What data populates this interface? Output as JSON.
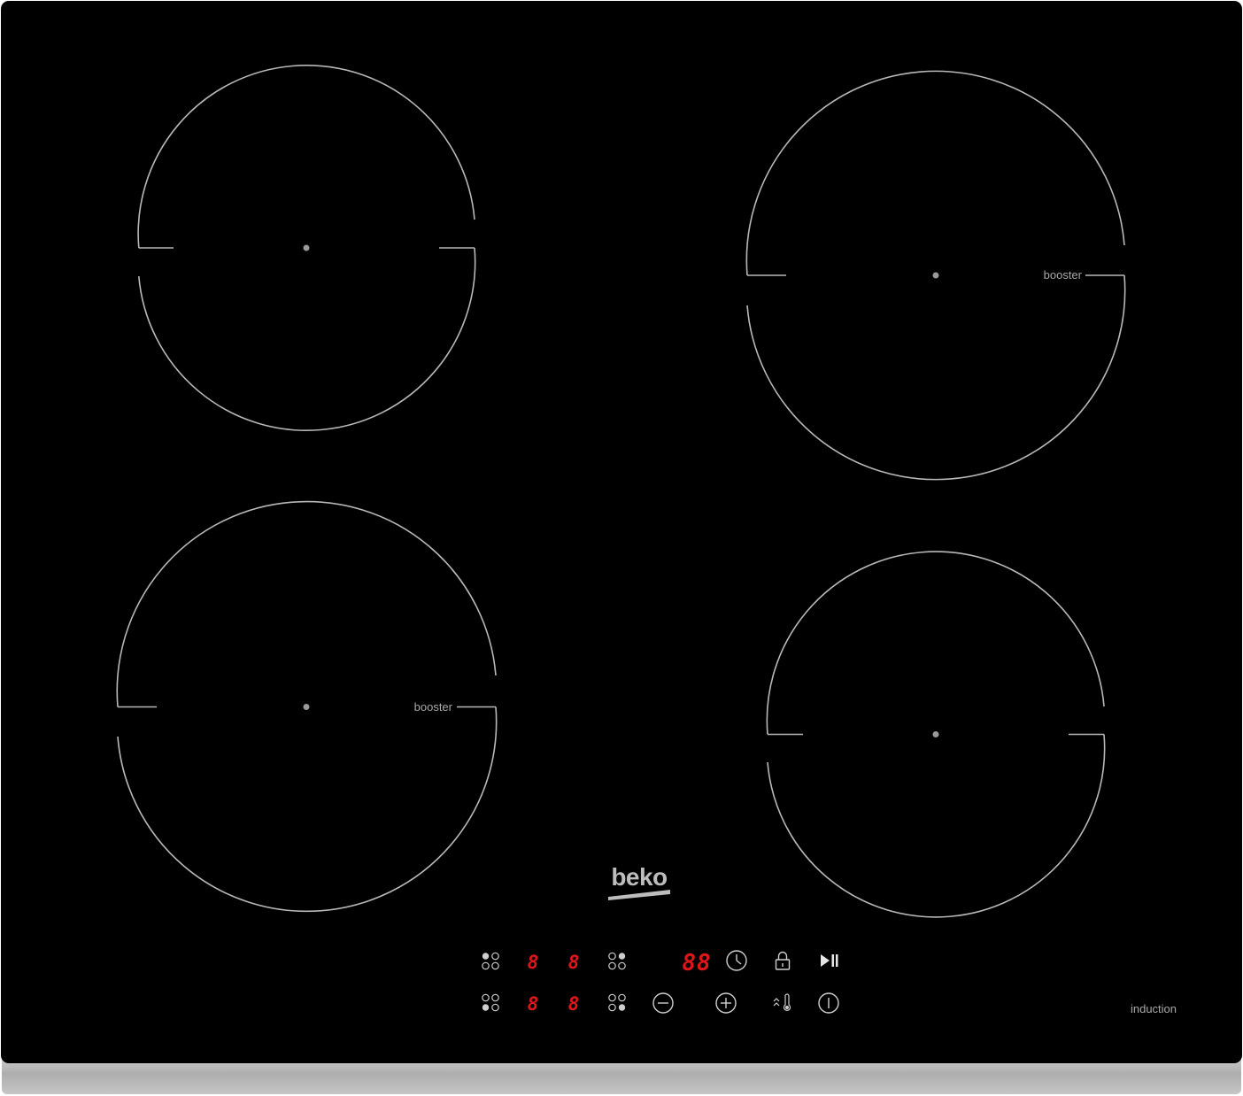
{
  "brand": "beko",
  "cooktop_type_label": "induction",
  "zones": [
    {
      "id": "rear-left",
      "label": ""
    },
    {
      "id": "rear-right",
      "label": "booster"
    },
    {
      "id": "front-left",
      "label": "booster"
    },
    {
      "id": "front-right",
      "label": ""
    }
  ],
  "control_panel": {
    "zone_selectors": [
      {
        "icon": "zone-selector-rear-left-icon"
      },
      {
        "icon": "zone-selector-rear-right-icon"
      },
      {
        "icon": "zone-selector-front-left-icon"
      },
      {
        "icon": "zone-selector-front-right-icon"
      }
    ],
    "power_digits": {
      "rear_left": "8",
      "rear_right": "8",
      "front_left": "8",
      "front_right": "8"
    },
    "timer_display": "88",
    "buttons": {
      "timer": "clock-icon",
      "lock": "lock-icon",
      "pause": "play-pause-icon",
      "minus": "minus-icon",
      "plus": "plus-icon",
      "keep_warm": "keep-warm-icon",
      "power": "power-icon"
    }
  },
  "colors": {
    "glass": "#000000",
    "ring": "#b8b8b8",
    "digit": "#e0161b",
    "frame": "#b4b4b4",
    "label": "#a8a8a8"
  }
}
